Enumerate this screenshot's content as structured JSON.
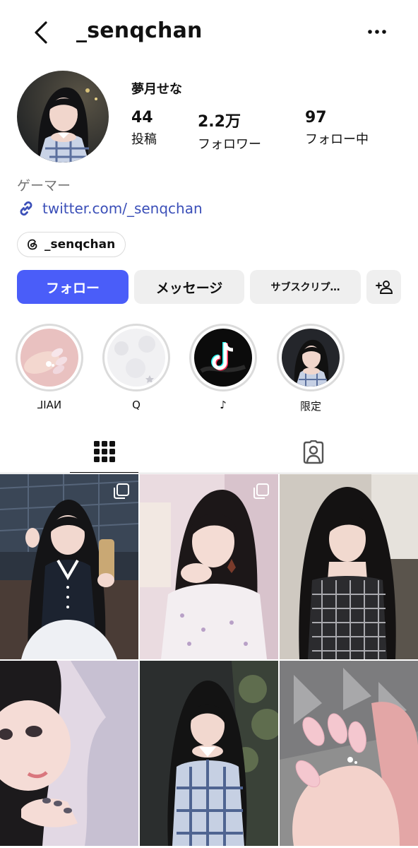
{
  "header": {
    "username": "_senqchan"
  },
  "profile": {
    "display_name": "夢月せな",
    "stats": [
      {
        "value": "44",
        "label": "投稿"
      },
      {
        "value": "2.2万",
        "label": "フォロワー"
      },
      {
        "value": "97",
        "label": "フォロー中"
      }
    ],
    "category": "ゲーマー",
    "link": "twitter.com/_senqchan",
    "threads_handle": "_senqchan"
  },
  "actions": {
    "follow": "フォロー",
    "message": "メッセージ",
    "subscribe": "サブスクリプ…"
  },
  "highlights": [
    {
      "label": "NAIL"
    },
    {
      "label": "Q"
    },
    {
      "label": "♪"
    },
    {
      "label": "限定"
    }
  ],
  "colors": {
    "accent": "#4a5df9",
    "link": "#3b4fb8",
    "secondary_button": "#efefef",
    "muted_text": "#737373"
  },
  "icons": {
    "back": "chevron-left-icon",
    "more": "more-horizontal-icon",
    "link": "link-icon",
    "threads": "threads-icon",
    "add_user": "add-user-icon",
    "grid_tab": "grid-icon",
    "tagged_tab": "tagged-user-icon",
    "multi_post": "multiple-posts-icon"
  }
}
